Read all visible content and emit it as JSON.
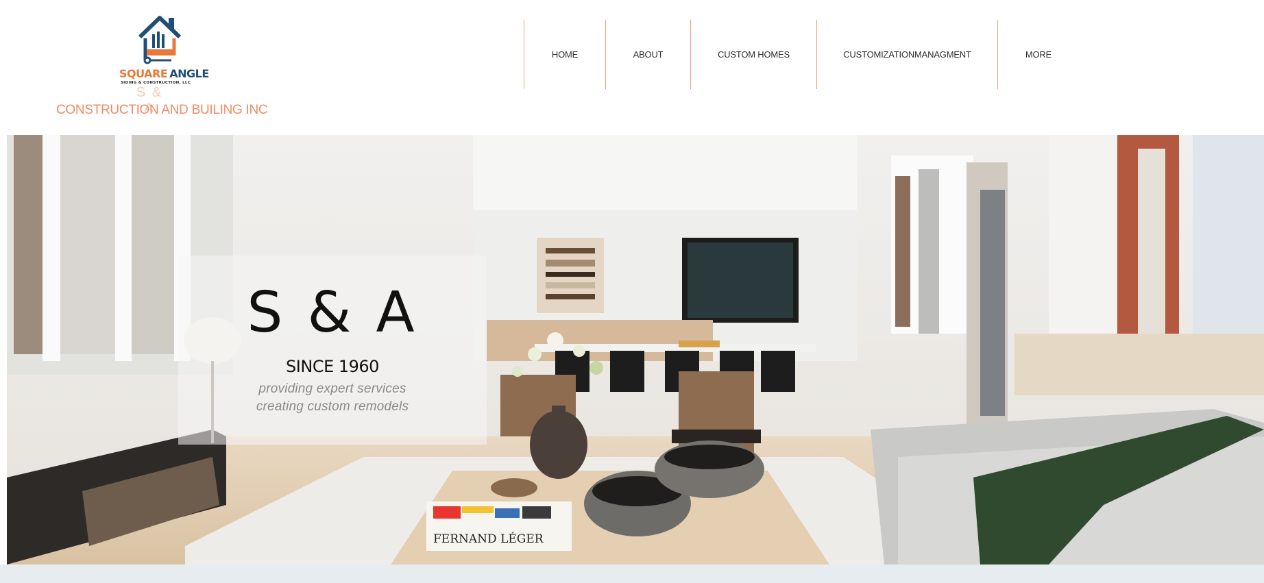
{
  "header": {
    "logo": {
      "word_part1": "SQUARE",
      "word_part2": "ANGLE",
      "tagline": "SIDING & CONSTRUCTION, LLC"
    },
    "brand_short": "S & A",
    "brand_long": "CONSTRUCTION AND BUILING INC"
  },
  "nav": {
    "items": [
      {
        "label": "HOME"
      },
      {
        "label": "ABOUT"
      },
      {
        "label": "CUSTOM HOMES"
      },
      {
        "label": "CUSTOMIZATIONMANAGMENT"
      },
      {
        "label": "MORE"
      }
    ]
  },
  "hero": {
    "title": "S & A",
    "since": "SINCE 1960",
    "line1": "providing expert services",
    "line2": "creating custom remodels",
    "book_title": "FERNAND LÉGER"
  },
  "colors": {
    "accent": "#f28a63",
    "logo_orange": "#e9793a",
    "logo_blue": "#1f4e79",
    "nav_divider": "#f2a07e",
    "footer_strip": "#e7ecf0"
  }
}
